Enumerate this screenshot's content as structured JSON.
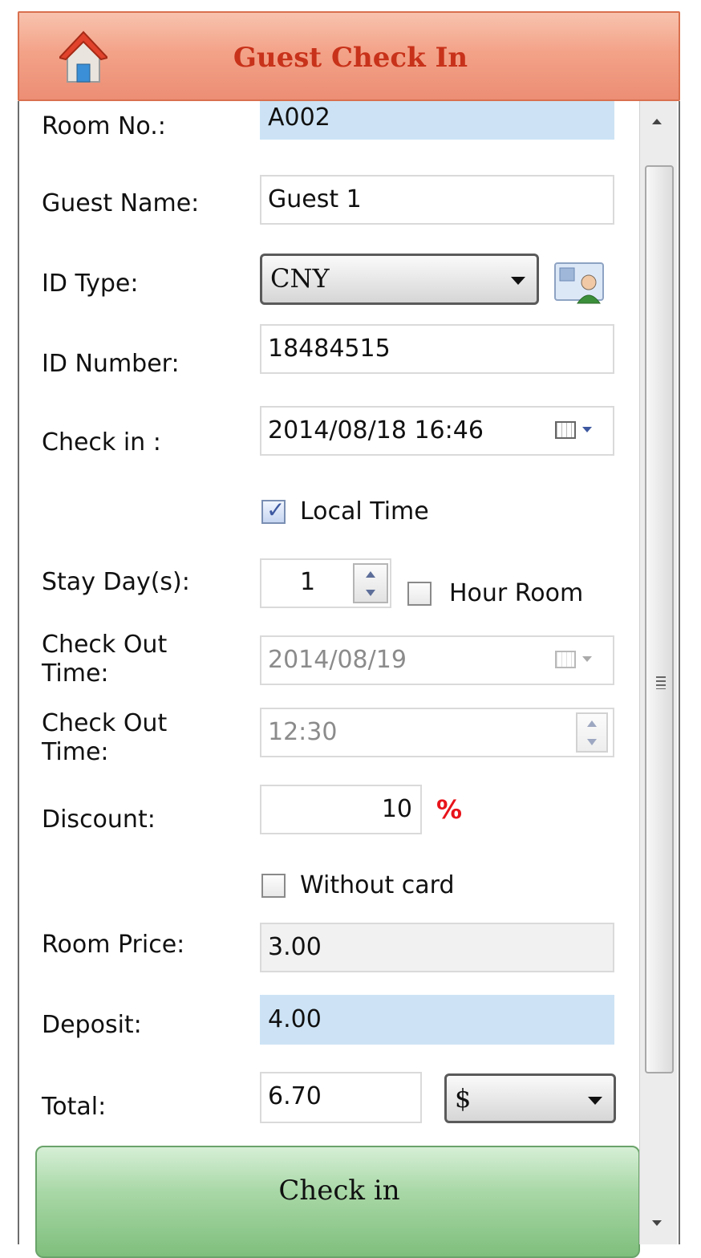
{
  "header": {
    "title": "Guest Check In",
    "icon": "home-icon"
  },
  "form": {
    "room_no_label": "Room No.:",
    "room_no_value": "A002",
    "guest_name_label": "Guest Name:",
    "guest_name_value": "Guest 1",
    "id_type_label": "ID Type:",
    "id_type_value": "CNY",
    "id_number_label": "ID Number:",
    "id_number_value": "18484515",
    "check_in_label": "Check in :",
    "check_in_value": "2014/08/18 16:46",
    "local_time_label": "Local Time",
    "local_time_checked": true,
    "stay_days_label": "Stay Day(s):",
    "stay_days_value": "1",
    "hour_room_label": "Hour Room",
    "hour_room_checked": false,
    "checkout_date_label": "Check Out\nTime:",
    "checkout_date_value": "2014/08/19",
    "checkout_time_label": "Check Out\nTime:",
    "checkout_time_value": "12:30",
    "discount_label": "Discount:",
    "discount_value": "10",
    "discount_unit": "%",
    "without_card_label": "Without card",
    "without_card_checked": false,
    "room_price_label": "Room Price:",
    "room_price_value": "3.00",
    "deposit_label": "Deposit:",
    "deposit_value": "4.00",
    "total_label": "Total:",
    "total_value": "6.70",
    "currency_value": "$"
  },
  "actions": {
    "check_in_button": "Check in"
  },
  "colors": {
    "header": "#ec8e75",
    "title": "#c8321a",
    "button": "#7fbf7c",
    "highlight_field": "#cde3f5",
    "percent": "#e8141b"
  }
}
